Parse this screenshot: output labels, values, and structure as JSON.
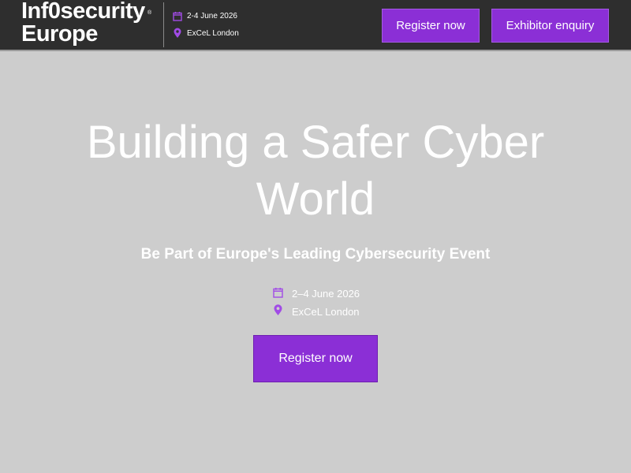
{
  "header": {
    "logo": {
      "line1": "Inf0security",
      "line2": "Europe",
      "reg": "®"
    },
    "event_date": "2-4 June 2026",
    "event_location": "ExCeL London",
    "register_label": "Register now",
    "exhibitor_label": "Exhibitor enquiry"
  },
  "hero": {
    "title": "Building a Safer Cyber World",
    "subtitle": "Be Part of Europe's Leading Cybersecurity Event",
    "date": "2–4 June 2026",
    "location": "ExCeL London",
    "cta_label": "Register now"
  },
  "colors": {
    "accent": "#8b2fd6",
    "header_bg": "#2e2e2e",
    "page_bg": "#cdcdcd"
  },
  "icons": {
    "date": "calendar-icon",
    "location": "map-pin-icon"
  }
}
